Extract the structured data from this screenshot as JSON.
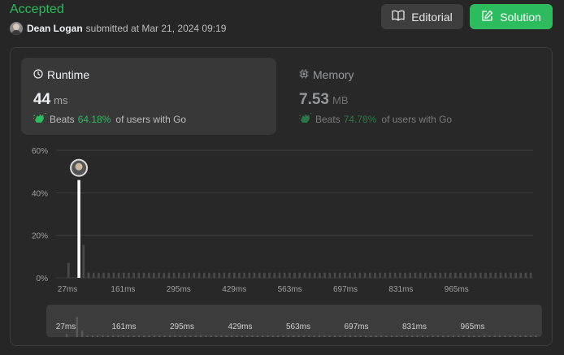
{
  "submission": {
    "status": "Accepted",
    "user_name": "Dean Logan",
    "submitted_text": "submitted at Mar 21, 2024 09:19"
  },
  "buttons": {
    "editorial": "Editorial",
    "solution": "Solution"
  },
  "runtime": {
    "title": "Runtime",
    "value": "44",
    "unit": "ms",
    "beats_label": "Beats",
    "beats_pct": "64.18%",
    "beats_suffix": "of users with Go"
  },
  "memory": {
    "title": "Memory",
    "value": "7.53",
    "unit": "MB",
    "beats_label": "Beats",
    "beats_pct": "74.78%",
    "beats_suffix": "of users with Go"
  },
  "colors": {
    "accent": "#2cbb5d",
    "bar": "#4a4a4a",
    "highlight_bar": "#ffffff",
    "grid": "#3e3e3e",
    "tick_text": "#a0a0a0"
  },
  "chart_data": {
    "type": "bar",
    "xlabel": "",
    "ylabel": "",
    "ylim": [
      0,
      60
    ],
    "yticks": [
      "60%",
      "40%",
      "20%",
      "0%"
    ],
    "ytick_values": [
      60,
      40,
      20,
      0
    ],
    "xticks": [
      "27ms",
      "161ms",
      "295ms",
      "429ms",
      "563ms",
      "697ms",
      "831ms",
      "965ms"
    ],
    "highlight_index": 2,
    "values": [
      7,
      0,
      46,
      15.5,
      2.4,
      2.4,
      2.4,
      2.4,
      2.4,
      2.4,
      2.4,
      2.4,
      2.4,
      2.4,
      2.4,
      2.4,
      2.4,
      2.4,
      2.4,
      2.4,
      2.4,
      2.4,
      2.4,
      2.4,
      2.4,
      2.4,
      2.4,
      2.4,
      2.4,
      2.4,
      2.4,
      2.4,
      2.4,
      2.4,
      2.4,
      2.4,
      2.4,
      2.4,
      2.4,
      2.4,
      2.4,
      2.4,
      2.4,
      2.4,
      2.4,
      2.4,
      2.4,
      2.4,
      2.4,
      2.4,
      2.4,
      2.4,
      2.4,
      2.4,
      2.4,
      2.4,
      2.4,
      2.4,
      2.4,
      2.4,
      2.4,
      2.4,
      2.4,
      2.4,
      2.4,
      2.4,
      2.4,
      2.4,
      2.4,
      2.4,
      2.4,
      2.4,
      2.4,
      2.4,
      2.4,
      2.4,
      2.4,
      2.4,
      2.4,
      2.4,
      2.4,
      2.4,
      2.4,
      2.4,
      2.4,
      2.4,
      2.4,
      2.4,
      2.4,
      2.4,
      2.4,
      2.4,
      2.4
    ]
  }
}
